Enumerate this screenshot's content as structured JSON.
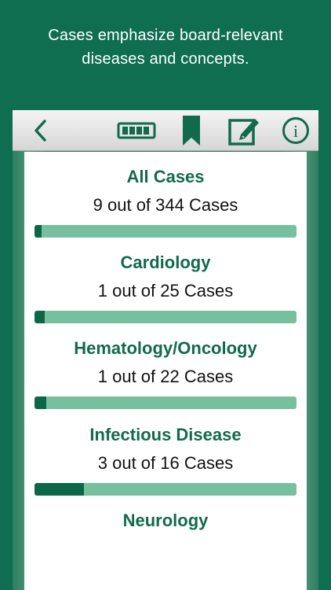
{
  "promo": {
    "line1": "Cases emphasize board-relevant",
    "line2": "diseases and concepts."
  },
  "toolbar": {
    "icons": [
      "back-icon",
      "progress-icon",
      "bookmark-icon",
      "edit-icon",
      "info-icon"
    ],
    "info_glyph": "i"
  },
  "colors": {
    "background": "#0f6e4f",
    "title": "#126a4c",
    "bar_track": "#77c09f",
    "bar_fill": "#0b6748"
  },
  "categories": [
    {
      "title": "All Cases",
      "count_text": "9 out of 344 Cases",
      "done": 9,
      "total": 344
    },
    {
      "title": "Cardiology",
      "count_text": "1 out of 25 Cases",
      "done": 1,
      "total": 25
    },
    {
      "title": "Hematology/Oncology",
      "count_text": "1 out of 22 Cases",
      "done": 1,
      "total": 22
    },
    {
      "title": "Infectious Disease",
      "count_text": "3 out of 16 Cases",
      "done": 3,
      "total": 16
    },
    {
      "title": "Neurology"
    }
  ]
}
